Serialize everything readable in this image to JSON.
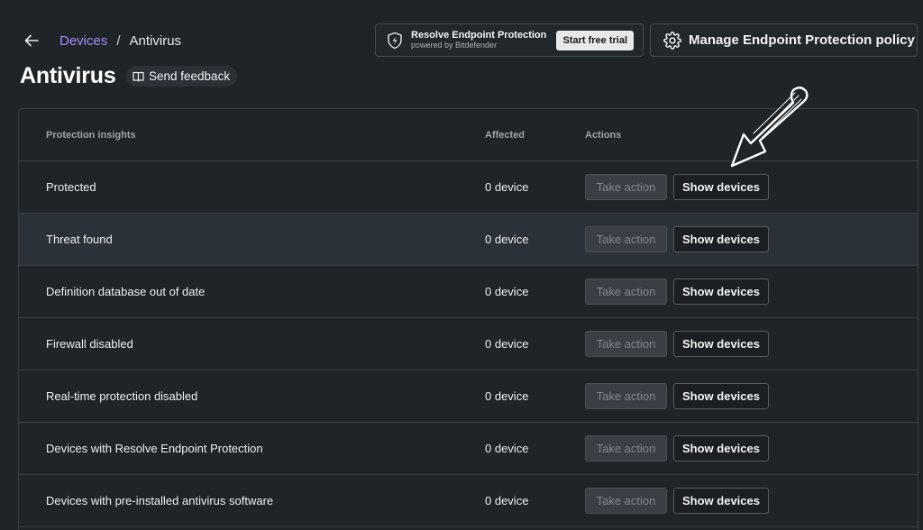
{
  "header": {
    "breadcrumb": {
      "parent": "Devices",
      "separator": "/",
      "current": "Antivirus"
    },
    "title": "Antivirus",
    "feedback_label": "Send feedback"
  },
  "promo": {
    "title": "Resolve Endpoint Protection",
    "subtitle": "powered by Bitdefender",
    "cta": "Start free trial"
  },
  "manage_button": "Manage Endpoint Protection policy",
  "table": {
    "columns": [
      "Protection insights",
      "Affected",
      "Actions"
    ],
    "take_action_label": "Take action",
    "show_devices_label": "Show devices",
    "rows": [
      {
        "name": "Protected",
        "affected": "0 device"
      },
      {
        "name": "Threat found",
        "affected": "0 device"
      },
      {
        "name": "Definition database out of date",
        "affected": "0 device"
      },
      {
        "name": "Firewall disabled",
        "affected": "0 device"
      },
      {
        "name": "Real-time protection disabled",
        "affected": "0 device"
      },
      {
        "name": "Devices with Resolve Endpoint Protection",
        "affected": "0 device"
      },
      {
        "name": "Devices with pre-installed antivirus software",
        "affected": "0 device"
      }
    ]
  },
  "colors": {
    "background": "#1f2428",
    "link": "#a78bfa",
    "border": "#3a4046",
    "row_hover": "#2a3138"
  },
  "icons": {
    "back": "arrow-left-icon",
    "feedback": "book-open-icon",
    "promo": "shield-bolt-icon",
    "manage": "gear-icon",
    "annotation": "hand-drawn-arrow-icon"
  }
}
